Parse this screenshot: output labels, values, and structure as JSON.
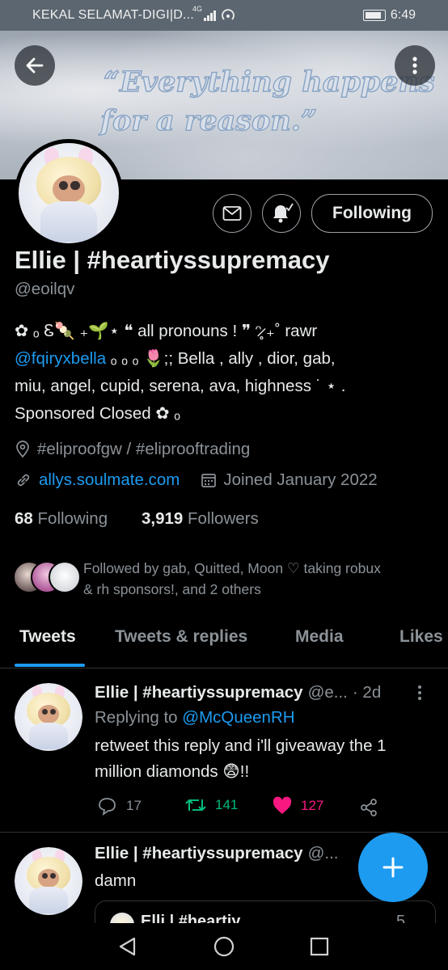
{
  "status_bar": {
    "carrier": "KEKAL SELAMAT-DIGI|D...",
    "network": "4G",
    "time": "6:49"
  },
  "banner": {
    "quote_line1": "“Everything happens",
    "quote_line2": "for a reason.”"
  },
  "profile": {
    "follow_button": "Following",
    "display_name": "Ellie | #heartiyssupremacy",
    "handle": "@eoilqv",
    "bio": {
      "line1": "✿ ₒ Ꮛ🍡 ₊🌱⋆ ❝ all pronouns ! ❞ ᵔ̷̥̥̥ ₊˚ rawr",
      "mention": "@fqiryxbella",
      "line2_rest": " ₒ ₒ ₒ 🌷;; Bella , ally , dior, gab,",
      "line3": "miu, angel, cupid, serena, ava, highness ˙ ⋆ .",
      "line4": "Sponsored Closed ✿ ₒ"
    },
    "location": "#eliproofgw / #eliprooftrading",
    "website": "allys.soulmate.com",
    "joined": "Joined January 2022",
    "following_count": "68",
    "following_label": "Following",
    "followers_count": "3,919",
    "followers_label": "Followers",
    "followed_by_line1": "Followed by gab, Quitted, Moon ♡ taking robux",
    "followed_by_line2": "& rh sponsors!, and 2 others"
  },
  "tabs": [
    "Tweets",
    "Tweets & replies",
    "Media",
    "Likes"
  ],
  "tweets": [
    {
      "name": "Ellie | #heartiyssupremacy",
      "handle": "@e...",
      "time": "· 2d",
      "replying_prefix": "Replying to ",
      "replying_to": "@McQueenRH",
      "text_line1": "retweet this reply and i'll giveaway the 1",
      "text_line2": "million diamonds 😨!!",
      "replies": "17",
      "retweets": "141",
      "likes": "127"
    },
    {
      "name": "Ellie | #heartiyssupremacy",
      "handle": "@...",
      "text": "damn",
      "quote_preview_name": "Elli | #heartiy",
      "quote_preview_time": "5"
    }
  ],
  "colors": {
    "accent": "#1d9bf0",
    "retweet": "#00ba7c",
    "like": "#f91880",
    "muted": "#8b9298"
  },
  "icons": {
    "back": "arrow-left-icon",
    "more": "more-vertical-icon",
    "message": "envelope-icon",
    "notify": "bell-check-icon",
    "location": "location-pin-icon",
    "link": "link-icon",
    "calendar": "calendar-icon",
    "reply": "comment-icon",
    "retweet": "retweet-icon",
    "like": "heart-filled-icon",
    "share": "share-icon",
    "compose": "plus-icon"
  }
}
